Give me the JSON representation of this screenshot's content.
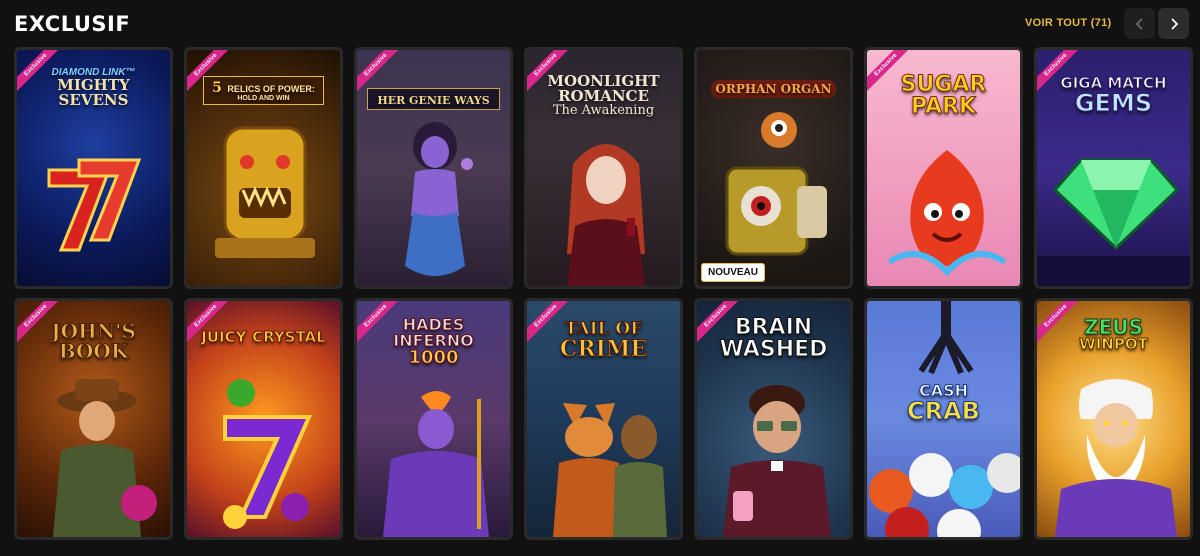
{
  "header": {
    "title": "EXCLUSIF",
    "see_all": "VOIR TOUT (71)",
    "prev_icon": "chevron-left-icon",
    "next_icon": "chevron-right-icon"
  },
  "ribbon_text": "Exclusive",
  "games": [
    {
      "name": "Diamond Link Mighty Sevens",
      "line1": "DIAMOND LINK™",
      "line2": "MIGHTY",
      "line3": "SEVENS",
      "exclusive": true,
      "badge": ""
    },
    {
      "name": "5 Relics of Power: Hold and Win",
      "line1": "5",
      "line2": "RELICS OF POWER:",
      "line3": "HOLD AND WIN",
      "exclusive": true,
      "badge": ""
    },
    {
      "name": "Her Genie Ways",
      "line1": "HER GENIE WAYS",
      "line2": "",
      "line3": "",
      "exclusive": true,
      "badge": ""
    },
    {
      "name": "Moonlight Romance The Awakening",
      "line1": "MOONLIGHT",
      "line2": "ROMANCE",
      "line3": "The Awakening",
      "exclusive": true,
      "badge": ""
    },
    {
      "name": "Orphan Organ",
      "line1": "ORPHAN ORGAN",
      "line2": "",
      "line3": "",
      "exclusive": false,
      "badge": "NOUVEAU"
    },
    {
      "name": "Sugar Park",
      "line1": "SUGAR",
      "line2": "PARK",
      "line3": "",
      "exclusive": true,
      "badge": ""
    },
    {
      "name": "Giga Match Gems",
      "line1": "GIGA MATCH",
      "line2": "GEMS",
      "line3": "",
      "exclusive": true,
      "badge": ""
    },
    {
      "name": "John's Book",
      "line1": "JOHN'S",
      "line2": "BOOK",
      "line3": "",
      "exclusive": true,
      "badge": ""
    },
    {
      "name": "Juicy Crystal",
      "line1": "JUICY",
      "line2": "CRYSTAL",
      "line3": "",
      "exclusive": true,
      "badge": ""
    },
    {
      "name": "Hades Inferno 1000",
      "line1": "HADES",
      "line2": "INFERNO",
      "line3": "1000",
      "exclusive": true,
      "badge": ""
    },
    {
      "name": "Tail of Crime",
      "line1": "TAIL OF",
      "line2": "CRIME",
      "line3": "",
      "exclusive": true,
      "badge": ""
    },
    {
      "name": "Brain Washed",
      "line1": "BRAIN",
      "line2": "WASHED",
      "line3": "",
      "exclusive": true,
      "badge": ""
    },
    {
      "name": "Cash Crab",
      "line1": "CASH",
      "line2": "CRAB",
      "line3": "",
      "exclusive": false,
      "badge": ""
    },
    {
      "name": "Zeus Winpot",
      "line1": "ZEUS",
      "line2": "WINPOT",
      "line3": "",
      "exclusive": true,
      "badge": ""
    }
  ],
  "colors": {
    "background": "#111111",
    "accent_gold": "#e8b84a",
    "ribbon_pink": "#d9268a"
  }
}
